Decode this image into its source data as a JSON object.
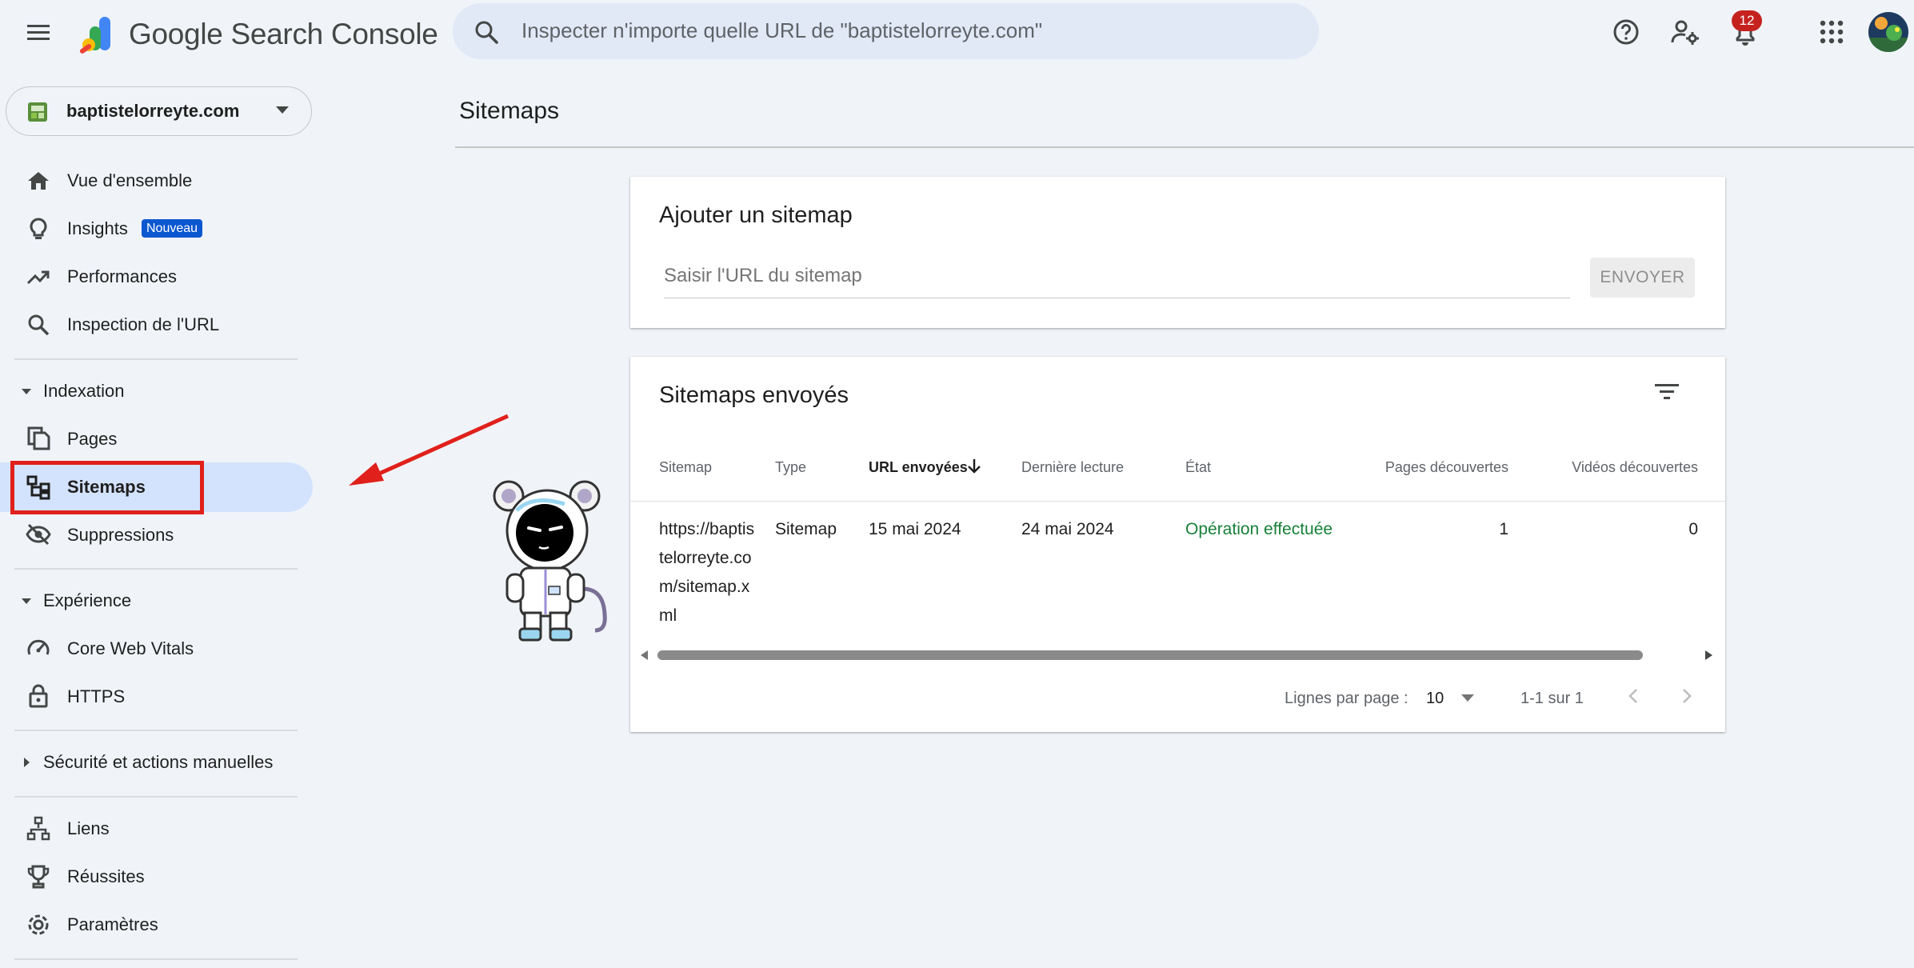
{
  "header": {
    "app_name": "Google Search Console",
    "search_placeholder": "Inspecter n'importe quelle URL de \"baptistelorreyte.com\"",
    "notification_count": "12"
  },
  "property": {
    "name": "baptistelorreyte.com"
  },
  "sidebar": {
    "items": [
      {
        "label": "Vue d'ensemble",
        "icon": "home-icon"
      },
      {
        "label": "Insights",
        "badge": "Nouveau",
        "icon": "lightbulb-icon"
      },
      {
        "label": "Performances",
        "icon": "trending-up-icon"
      },
      {
        "label": "Inspection de l'URL",
        "icon": "search-icon"
      }
    ],
    "indexation": {
      "label": "Indexation",
      "items": [
        {
          "label": "Pages",
          "icon": "pages-icon"
        },
        {
          "label": "Sitemaps",
          "icon": "sitemap-icon",
          "active": true
        },
        {
          "label": "Suppressions",
          "icon": "eye-off-icon"
        }
      ]
    },
    "experience": {
      "label": "Expérience",
      "items": [
        {
          "label": "Core Web Vitals",
          "icon": "speedometer-icon"
        },
        {
          "label": "HTTPS",
          "icon": "lock-icon"
        }
      ]
    },
    "security": {
      "label": "Sécurité et actions manuelles"
    },
    "bottom_items": [
      {
        "label": "Liens",
        "icon": "links-icon"
      },
      {
        "label": "Réussites",
        "icon": "trophy-icon"
      },
      {
        "label": "Paramètres",
        "icon": "gear-icon"
      }
    ]
  },
  "main": {
    "title": "Sitemaps",
    "add_card": {
      "title": "Ajouter un sitemap",
      "input_placeholder": "Saisir l'URL du sitemap",
      "submit_label": "ENVOYER"
    },
    "submitted_card": {
      "title": "Sitemaps envoyés",
      "columns": [
        "Sitemap",
        "Type",
        "URL envoyées",
        "Dernière lecture",
        "État",
        "Pages découvertes",
        "Vidéos découvertes"
      ],
      "sorted_column": "URL envoyées",
      "rows": [
        {
          "sitemap": "https://baptistelorreyte.com/sitemap.xml",
          "type": "Sitemap",
          "submitted": "15 mai 2024",
          "last_read": "24 mai 2024",
          "status": "Opération effectuée",
          "pages": "1",
          "videos": "0"
        }
      ],
      "footer": {
        "rows_per_page_label": "Lignes par page :",
        "rows_per_page_value": "10",
        "range": "1-1 sur 1"
      }
    }
  },
  "colors": {
    "background": "#f0f4f9",
    "active": "#d3e3fd",
    "accent": "#0b57d0",
    "success": "#188038",
    "annotation": "#e0201b"
  }
}
